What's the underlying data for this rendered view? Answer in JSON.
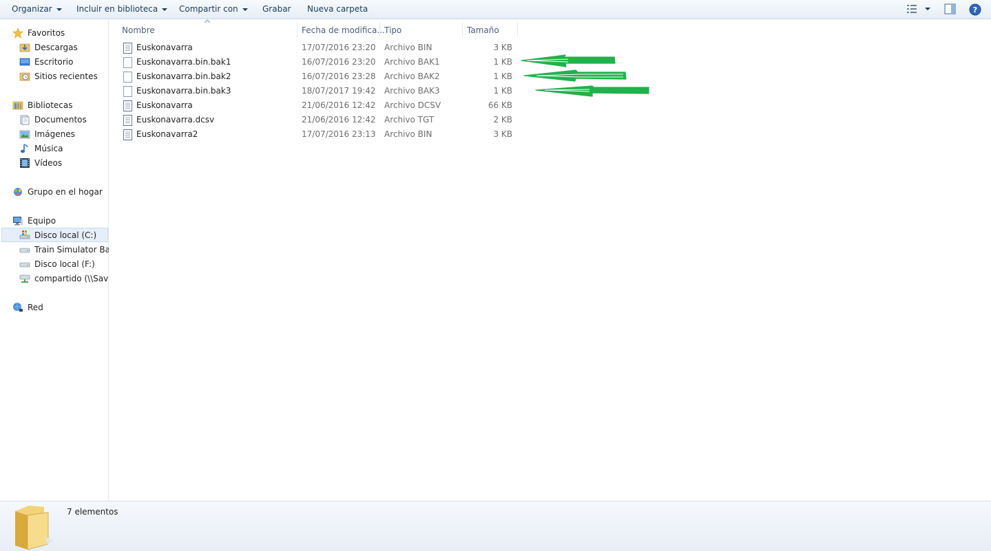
{
  "toolbar": {
    "organize": "Organizar",
    "include_library": "Incluir en biblioteca",
    "share_with": "Compartir con",
    "burn": "Grabar",
    "new_folder": "Nueva carpeta"
  },
  "nav": {
    "favorites": "Favoritos",
    "downloads": "Descargas",
    "desktop": "Escritorio",
    "recent": "Sitios recientes",
    "libraries": "Bibliotecas",
    "documents": "Documentos",
    "images": "Imágenes",
    "music": "Música",
    "videos": "Vídeos",
    "homegroup": "Grupo en el hogar",
    "computer": "Equipo",
    "disk_c": "Disco local (C:)",
    "train_sim": "Train Simulator Back",
    "disk_f": "Disco local (F:)",
    "shared": "compartido (\\\\Savis-",
    "network": "Red"
  },
  "columns": {
    "name": "Nombre",
    "date": "Fecha de modifica...",
    "type": "Tipo",
    "size": "Tamaño"
  },
  "files": [
    {
      "name": "Euskonavarra",
      "date": "17/07/2016 23:20",
      "type": "Archivo BIN",
      "size": "3 KB",
      "icon": "lined-file-icon"
    },
    {
      "name": "Euskonavarra.bin.bak1",
      "date": "16/07/2016 23:20",
      "type": "Archivo BAK1",
      "size": "1 KB",
      "icon": "blank-file-icon"
    },
    {
      "name": "Euskonavarra.bin.bak2",
      "date": "16/07/2016 23:28",
      "type": "Archivo BAK2",
      "size": "1 KB",
      "icon": "blank-file-icon"
    },
    {
      "name": "Euskonavarra.bin.bak3",
      "date": "18/07/2017 19:42",
      "type": "Archivo BAK3",
      "size": "1 KB",
      "icon": "blank-file-icon"
    },
    {
      "name": "Euskonavarra",
      "date": "21/06/2016 12:42",
      "type": "Archivo DCSV",
      "size": "66 KB",
      "icon": "lined-file-icon"
    },
    {
      "name": "Euskonavarra.dcsv",
      "date": "21/06/2016 12:42",
      "type": "Archivo TGT",
      "size": "2 KB",
      "icon": "lined-file-icon"
    },
    {
      "name": "Euskonavarra2",
      "date": "17/07/2016 23:13",
      "type": "Archivo BIN",
      "size": "3 KB",
      "icon": "lined-file-icon"
    }
  ],
  "status": {
    "count": "7 elementos"
  },
  "colors": {
    "annotation_arrow": "#22b14c",
    "toolbar_text": "#1e395b",
    "selected_bg": "#e5eef9"
  }
}
